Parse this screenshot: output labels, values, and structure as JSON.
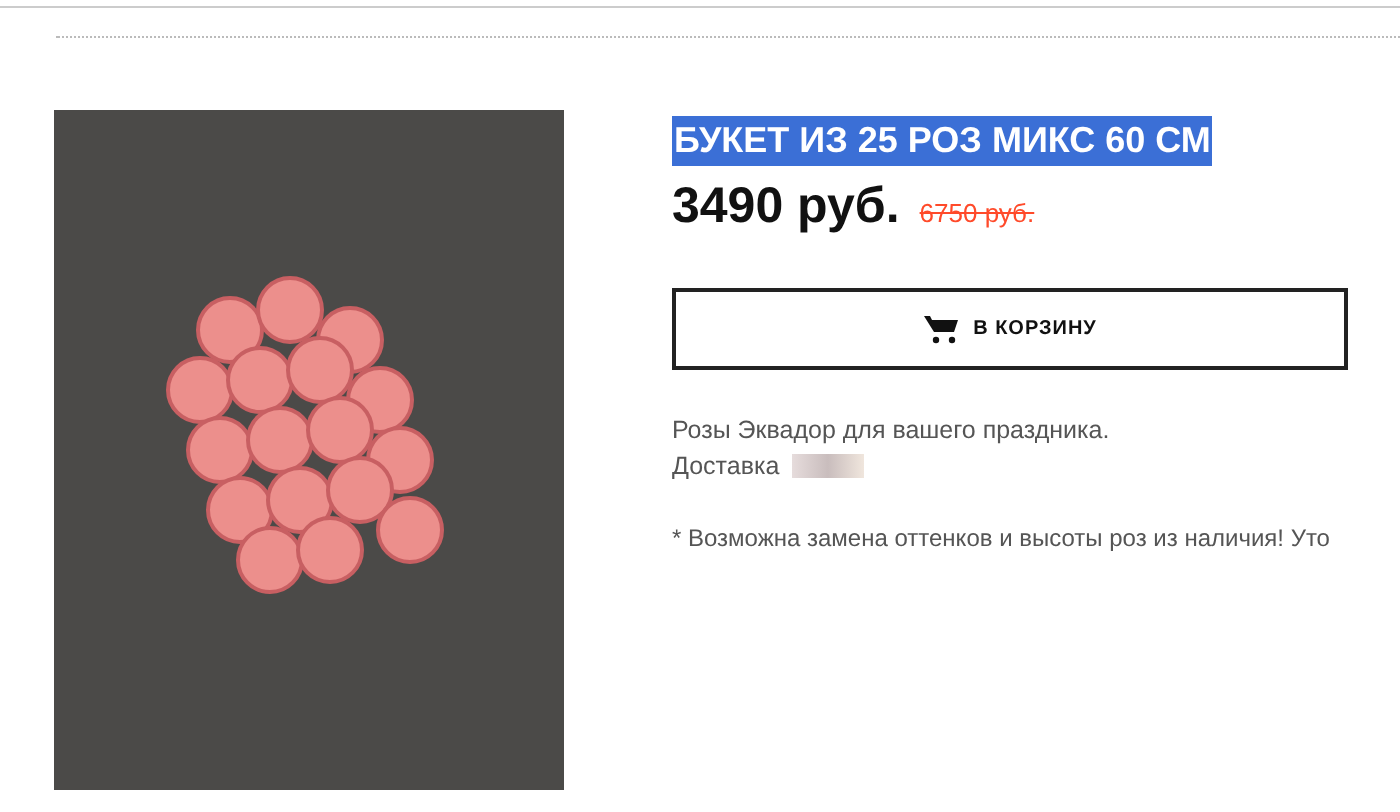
{
  "product": {
    "title": "БУКЕТ ИЗ 25 РОЗ МИКС 60 СМ",
    "title_highlighted": true,
    "price": "3490 руб.",
    "old_price": "6750 руб.",
    "cart_button": "В КОРЗИНУ",
    "description": "Розы Эквадор для вашего праздника.",
    "delivery_label": "Доставка",
    "note": "* Возможна замена оттенков и высоты роз из наличия! Уто"
  }
}
